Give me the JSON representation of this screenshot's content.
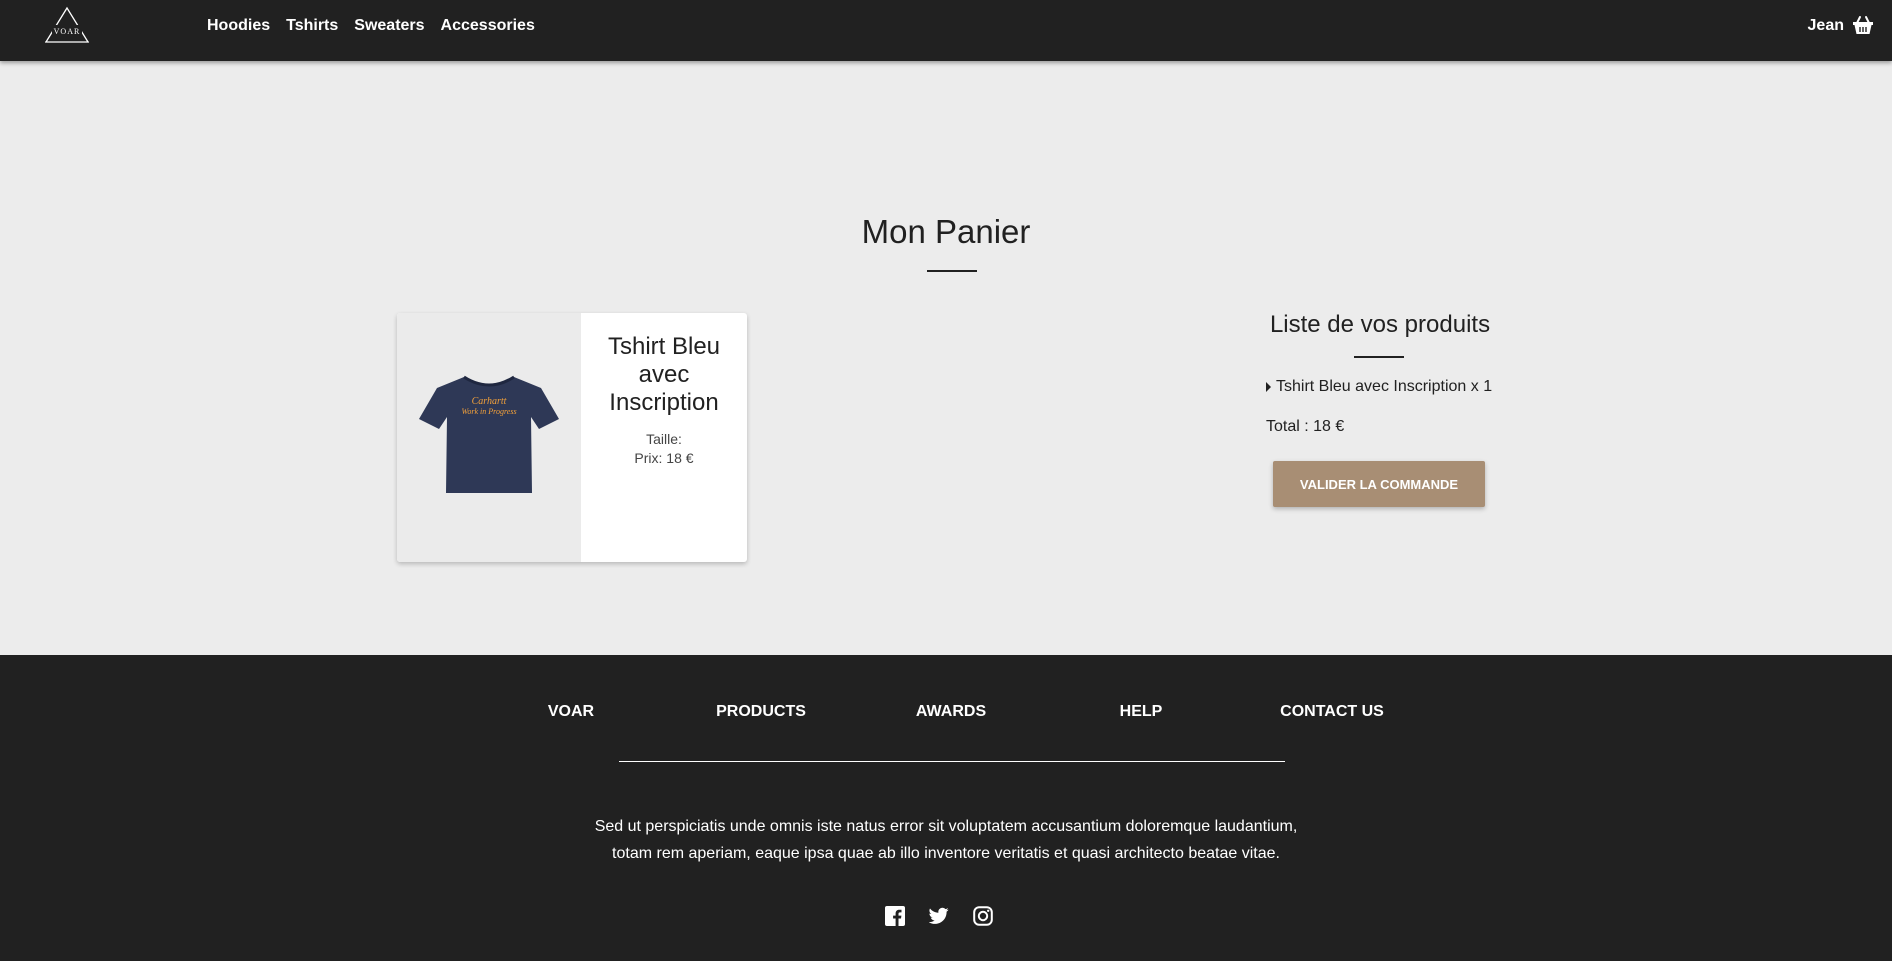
{
  "navbar": {
    "logo_text": "VOAR",
    "links": [
      "Hoodies",
      "Tshirts",
      "Sweaters",
      "Accessories"
    ],
    "user": "Jean",
    "cart_icon": "shopping-basket-icon"
  },
  "main": {
    "title": "Mon Panier",
    "product": {
      "name": "Tshirt Bleu avec Inscription",
      "size": "Taille:",
      "price": "Prix: 18 €"
    },
    "summary": {
      "title": "Liste de vos produits",
      "items": [
        "Tshirt Bleu avec Inscription x 1"
      ],
      "total": "Total : 18 €",
      "button": "VALIDER LA COMMANDE"
    }
  },
  "footer": {
    "links": [
      "VOAR",
      "PRODUCTS",
      "AWARDS",
      "HELP",
      "CONTACT US"
    ],
    "text_line1": "Sed ut perspiciatis unde omnis iste natus error sit voluptatem accusantium doloremque laudantium,",
    "text_line2": "totam rem aperiam, eaque ipsa quae ab illo inventore veritatis et quasi architecto beatae vitae.",
    "social_icons": [
      "facebook-icon",
      "twitter-icon",
      "instagram-icon"
    ]
  },
  "colors": {
    "navbar_bg": "#212121",
    "page_bg": "#ececec",
    "button_bg": "#a88e74",
    "tshirt": "#2e3856",
    "tshirt_print": "#f2a03a"
  }
}
